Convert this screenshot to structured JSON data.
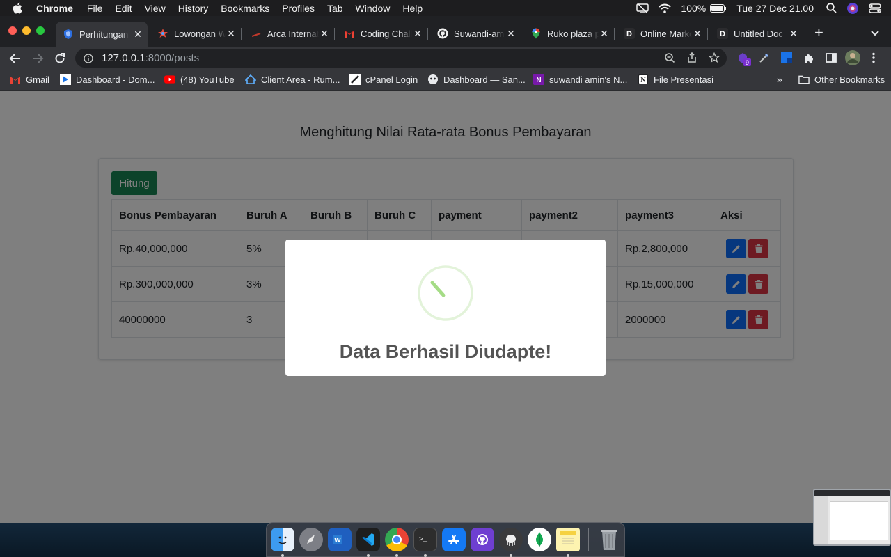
{
  "menubar": {
    "app_name": "Chrome",
    "menus": [
      "File",
      "Edit",
      "View",
      "History",
      "Bookmarks",
      "Profiles",
      "Tab",
      "Window",
      "Help"
    ],
    "battery": "100%",
    "datetime": "Tue 27 Dec  21.00"
  },
  "tabs": [
    {
      "title": "Perhitungan",
      "icon": "shield-icon",
      "active": true
    },
    {
      "title": "Lowongan W",
      "icon": "star-logo-icon",
      "active": false
    },
    {
      "title": "Arca Internat",
      "icon": "arca-logo-icon",
      "active": false
    },
    {
      "title": "Coding Chall",
      "icon": "gmail-icon",
      "active": false
    },
    {
      "title": "Suwandi-amin",
      "icon": "github-icon",
      "active": false
    },
    {
      "title": "Ruko plaza p",
      "icon": "maps-pin-icon",
      "active": false
    },
    {
      "title": "Online Marke",
      "icon": "d-logo-icon",
      "active": false
    },
    {
      "title": "Untitled Doc",
      "icon": "d-logo-icon",
      "active": false
    }
  ],
  "address": {
    "host": "127.0.0.1",
    "path": ":8000/posts"
  },
  "extensions": {
    "badge_count": "9"
  },
  "bookmarks": [
    {
      "label": "Gmail",
      "icon": "gmail-icon"
    },
    {
      "label": "Dashboard - Dom...",
      "icon": "dashboard-icon"
    },
    {
      "label": "(48) YouTube",
      "icon": "youtube-icon"
    },
    {
      "label": "Client Area - Rum...",
      "icon": "client-area-icon"
    },
    {
      "label": "cPanel Login",
      "icon": "cpanel-icon"
    },
    {
      "label": "Dashboard — San...",
      "icon": "sanity-icon"
    },
    {
      "label": "suwandi amin's N...",
      "icon": "onenote-icon"
    },
    {
      "label": "File Presentasi",
      "icon": "notion-icon"
    }
  ],
  "bookmarks_more": "»",
  "other_bookmarks": "Other Bookmarks",
  "page": {
    "title": "Menghitung Nilai Rata-rata Bonus Pembayaran",
    "hitung_button": "Hitung",
    "table": {
      "headers": [
        "Bonus Pembayaran",
        "Buruh A",
        "Buruh B",
        "Buruh C",
        "payment",
        "payment2",
        "payment3",
        "Aksi"
      ],
      "rows": [
        [
          "Rp.40,000,000",
          "5%",
          "",
          "",
          "",
          "",
          "Rp.2,800,000"
        ],
        [
          "Rp.300,000,000",
          "3%",
          "",
          "",
          "",
          "",
          "Rp.15,000,000"
        ],
        [
          "40000000",
          "3",
          "",
          "",
          "",
          "",
          "2000000"
        ]
      ]
    }
  },
  "modal": {
    "message": "Data Berhasil Diudapte!",
    "success_color": "#a5dc86"
  },
  "dock": {
    "apps": [
      "finder",
      "launchpad",
      "word",
      "vscode",
      "chrome",
      "terminal",
      "app-store",
      "github-desktop",
      "sequel-ace",
      "mongodb-compass",
      "notes",
      "trash"
    ]
  }
}
